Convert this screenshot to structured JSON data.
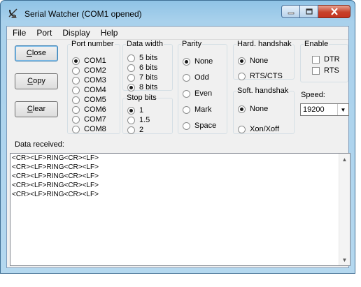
{
  "window": {
    "title": "Serial Watcher (COM1 opened)",
    "icons": {
      "app": "satellite-dish-icon",
      "minimize": "minimize-icon",
      "maximize": "maximize-icon",
      "close": "close-icon"
    }
  },
  "menu": [
    "File",
    "Port",
    "Display",
    "Help"
  ],
  "buttons": {
    "close": {
      "key": "C",
      "rest": "lose"
    },
    "copy": {
      "key": "C",
      "rest": "opy"
    },
    "clear": {
      "key": "C",
      "rest": "lear"
    }
  },
  "port_number": {
    "legend": "Port number",
    "options": [
      "COM1",
      "COM2",
      "COM3",
      "COM4",
      "COM5",
      "COM6",
      "COM7",
      "COM8"
    ],
    "selected": "COM1"
  },
  "data_width": {
    "legend": "Data width",
    "options": [
      "5 bits",
      "6 bits",
      "7 bits",
      "8 bits"
    ],
    "selected": "8 bits"
  },
  "stop_bits": {
    "legend": "Stop bits",
    "options": [
      "1",
      "1.5",
      "2"
    ],
    "selected": "1"
  },
  "parity": {
    "legend": "Parity",
    "options": [
      "None",
      "Odd",
      "Even",
      "Mark",
      "Space"
    ],
    "selected": "None"
  },
  "hard_handshake": {
    "legend": "Hard. handshak",
    "options": [
      "None",
      "RTS/CTS"
    ],
    "selected": "None"
  },
  "soft_handshake": {
    "legend": "Soft. handshak",
    "options": [
      "None",
      "Xon/Xoff"
    ],
    "selected": "None"
  },
  "enable": {
    "legend": "Enable",
    "options": [
      {
        "label": "DTR",
        "checked": false
      },
      {
        "label": "RTS",
        "checked": false
      }
    ]
  },
  "speed": {
    "label": "Speed:",
    "value": "19200"
  },
  "data_received": {
    "label": "Data received:",
    "lines": [
      "<CR><LF>RING<CR><LF>",
      "<CR><LF>RING<CR><LF>",
      "<CR><LF>RING<CR><LF>",
      "<CR><LF>RING<CR><LF>",
      "<CR><LF>RING<CR><LF>"
    ]
  }
}
